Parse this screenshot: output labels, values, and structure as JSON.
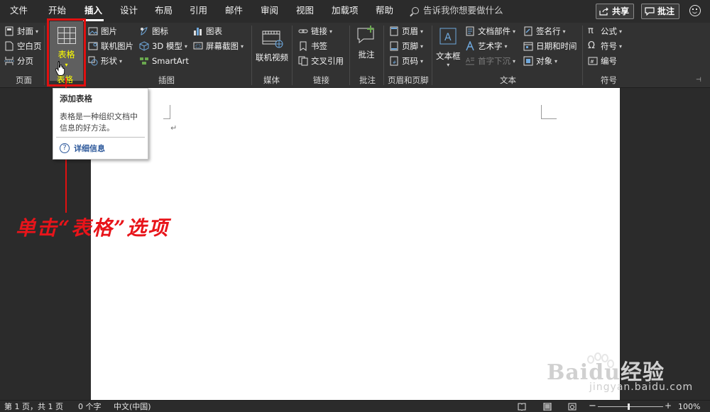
{
  "menu": {
    "tabs": [
      "文件",
      "开始",
      "插入",
      "设计",
      "布局",
      "引用",
      "邮件",
      "审阅",
      "视图",
      "加载项",
      "帮助"
    ],
    "active": "插入",
    "tellme_placeholder": "告诉我你想要做什么",
    "share_label": "共享",
    "comment_label": "批注"
  },
  "ribbon": {
    "pages": {
      "cover": "封面",
      "blank": "空白页",
      "pagebreak": "分页",
      "label": "页面"
    },
    "table": {
      "button": "表格",
      "label": "表格"
    },
    "illustrations": {
      "pictures": "图片",
      "online_pictures": "联机图片",
      "shapes": "形状",
      "icons": "图标",
      "model3d": "3D 模型",
      "smartart": "SmartArt",
      "chart": "图表",
      "screenshot": "屏幕截图",
      "label": "插图"
    },
    "media": {
      "online_video": "联机视频",
      "label": "媒体"
    },
    "links": {
      "link": "链接",
      "bookmark": "书签",
      "crossref": "交叉引用",
      "label": "链接"
    },
    "comments": {
      "comment": "批注",
      "label": "批注"
    },
    "header_footer": {
      "header": "页眉",
      "footer": "页脚",
      "page_number": "页码",
      "label": "页眉和页脚"
    },
    "text": {
      "textbox": "文本框",
      "quickparts": "文档部件",
      "wordart": "艺术字",
      "dropcap": "首字下沉",
      "signature": "签名行",
      "datetime": "日期和时间",
      "object": "对象",
      "label": "文本"
    },
    "symbols": {
      "equation": "公式",
      "symbol": "符号",
      "number": "编号",
      "label": "符号"
    }
  },
  "tooltip": {
    "title": "添加表格",
    "description": "表格是一种组织文档中信息的好方法。",
    "link": "详细信息"
  },
  "annotation": "单击“表格”选项",
  "document": {
    "paragraph_mark": "↵"
  },
  "watermark": {
    "brand": "Baidu经验",
    "url": "jingyan.baidu.com"
  },
  "status": {
    "page": "第 1 页，共 1 页",
    "words": "0 个字",
    "language": "中文(中国)",
    "zoom": "100%"
  },
  "colors": {
    "accent_red": "#e01010",
    "highlight_yellow": "#ffff00",
    "link_blue": "#2b579a"
  }
}
